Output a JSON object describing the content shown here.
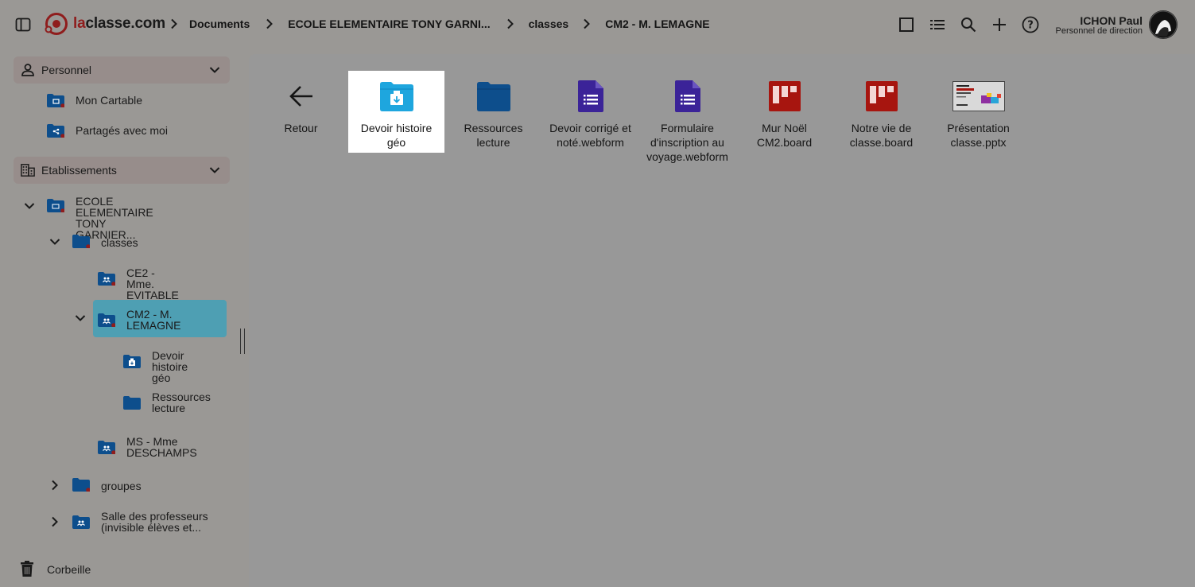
{
  "brand": {
    "part1": "la",
    "part2": "classe.com"
  },
  "breadcrumb": [
    "Documents",
    "ECOLE ELEMENTAIRE TONY GARNI...",
    "classes",
    "CM2 - M. LEMAGNE"
  ],
  "top_actions": [
    "square-view-icon",
    "list-view-icon",
    "search-icon",
    "add-icon",
    "help-icon"
  ],
  "user": {
    "name": "ICHON Paul",
    "role": "Personnel de direction"
  },
  "sidebar": {
    "personnel": {
      "label": "Personnel",
      "items": [
        {
          "label": "Mon Cartable"
        },
        {
          "label": "Partagés avec moi"
        }
      ]
    },
    "etablissements": {
      "label": "Etablissements",
      "tree": [
        {
          "label1": "ECOLE ELEMENTAIRE",
          "label2": "TONY GARNIER..."
        },
        {
          "label1": "classes"
        },
        {
          "label1": "CE2 - Mme.",
          "label2": "EVITABLE"
        },
        {
          "label1": "CM2 - M.",
          "label2": "LEMAGNE"
        },
        {
          "label1": "Devoir",
          "label2": "histoire géo"
        },
        {
          "label1": "Ressources",
          "label2": "lecture"
        },
        {
          "label1": "MS - Mme",
          "label2": "DESCHAMPS"
        },
        {
          "label1": "groupes"
        },
        {
          "label1": "Salle des professeurs",
          "label2": "(invisible élèves et..."
        }
      ]
    },
    "trash": {
      "label": "Corbeille"
    }
  },
  "files": [
    {
      "l1": "Retour",
      "l2": "",
      "l3": ""
    },
    {
      "l1": "Devoir histoire",
      "l2": "géo",
      "l3": ""
    },
    {
      "l1": "Ressources",
      "l2": "lecture",
      "l3": ""
    },
    {
      "l1": "Devoir corrigé et",
      "l2": "noté.webform",
      "l3": ""
    },
    {
      "l1": "Formulaire",
      "l2": "d'inscription au",
      "l3": "voyage.webform"
    },
    {
      "l1": "Mur Noël",
      "l2": "CM2.board",
      "l3": ""
    },
    {
      "l1": "Notre vie de",
      "l2": "classe.board",
      "l3": ""
    },
    {
      "l1": "Présentation",
      "l2": "classe.pptx",
      "l3": ""
    }
  ],
  "colors": {
    "folder": "#0d4e8c",
    "folder_selected": "#1ea6de",
    "webform": "#3b2398",
    "board": "#a7150f",
    "selected_tree": "#4e9fb3",
    "brand_red": "#8f1d1d"
  }
}
